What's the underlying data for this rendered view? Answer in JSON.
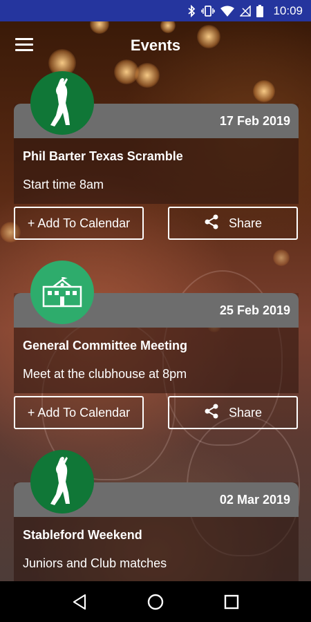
{
  "status_bar": {
    "time": "10:09",
    "icons": [
      "bluetooth-icon",
      "vibrate-icon",
      "wifi-icon",
      "no-signal-icon",
      "battery-icon"
    ]
  },
  "app_bar": {
    "title": "Events",
    "menu_icon": "hamburger-menu-icon"
  },
  "events": [
    {
      "date": "17 Feb 2019",
      "title": "Phil Barter Texas Scramble",
      "description": "Start time 8am",
      "icon": "golfer-icon",
      "calendar_label": "+ Add To Calendar",
      "share_label": "Share"
    },
    {
      "date": "25 Feb 2019",
      "title": "General Committee Meeting",
      "description": "Meet at the clubhouse at 8pm",
      "icon": "clubhouse-icon",
      "calendar_label": "+ Add To Calendar",
      "share_label": "Share"
    },
    {
      "date": "02 Mar 2019",
      "title": "Stableford Weekend",
      "description": "Juniors and Club matches",
      "icon": "golfer-icon"
    }
  ],
  "colors": {
    "status_bar": "#25359e",
    "card_header": "#6d6d6d",
    "golf_avatar": "#107737",
    "clubhouse_avatar": "#2eac6c"
  },
  "nav_bar": {
    "icons": [
      "back-icon",
      "home-icon",
      "recents-icon"
    ]
  }
}
